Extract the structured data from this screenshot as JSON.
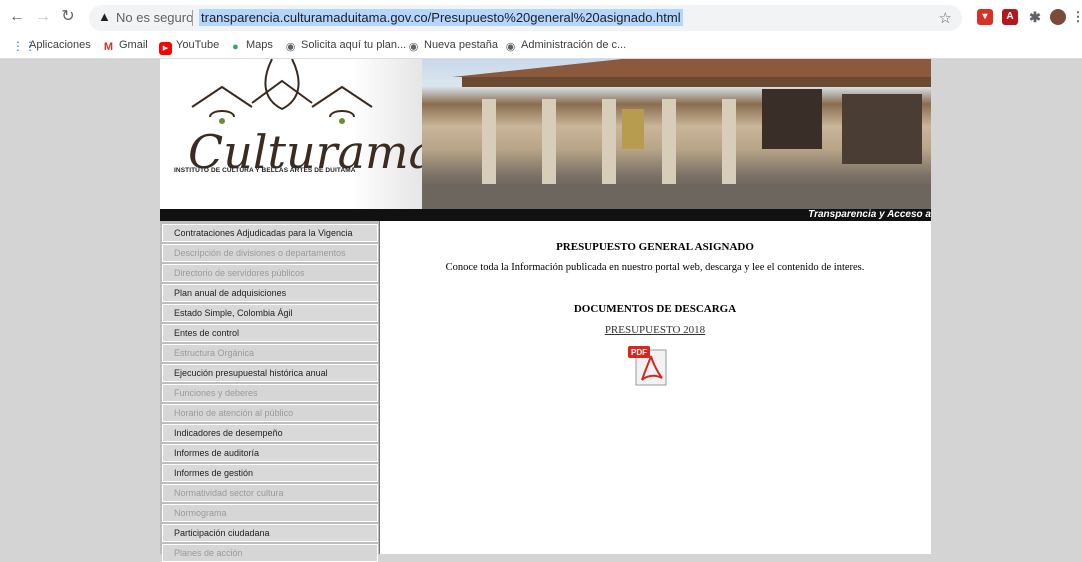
{
  "browser": {
    "insecure_label": "No es seguro",
    "url": "transparencia.culturamaduitama.gov.co/Presupuesto%20general%20asignado.html",
    "bookmarks": [
      "Aplicaciones",
      "Gmail",
      "YouTube",
      "Maps",
      "Solicita aquí tu plan...",
      "Nueva pestaña",
      "Administración de c..."
    ]
  },
  "banner": {
    "logo": "Culturama",
    "subtitle": "INSTITUTO DE CULTURA Y BELLAS ARTES DE DUITAMA",
    "tagline": "Transparencia y Acceso a"
  },
  "sidebar": {
    "items": [
      {
        "label": "Contrataciones Adjudicadas para la Vigencia",
        "dim": false
      },
      {
        "label": "Descripción de divisiones o departamentos",
        "dim": true
      },
      {
        "label": "Directorio de servidores públicos",
        "dim": true
      },
      {
        "label": "Plan anual de adquisiciones",
        "dim": false
      },
      {
        "label": "Estado Simple, Colombia Ágil",
        "dim": false
      },
      {
        "label": "Entes de control",
        "dim": false
      },
      {
        "label": "Estructura Orgánica",
        "dim": true
      },
      {
        "label": "Ejecución presupuestal histórica anual",
        "dim": false
      },
      {
        "label": "Funciones y deberes",
        "dim": true
      },
      {
        "label": "Horario de atención al público",
        "dim": true
      },
      {
        "label": "Indicadores de desempeño",
        "dim": false
      },
      {
        "label": "Informes de auditoría",
        "dim": false
      },
      {
        "label": "Informes de gestión",
        "dim": false
      },
      {
        "label": "Normatividad sector cultura",
        "dim": true
      },
      {
        "label": "Normograma",
        "dim": true
      },
      {
        "label": "Participación ciudadana",
        "dim": false
      },
      {
        "label": "Planes de acción",
        "dim": true
      }
    ]
  },
  "content": {
    "title": "PRESUPUESTO GENERAL ASIGNADO",
    "intro": "Conoce toda la Información publicada en nuestro portal web, descarga y lee el contenido de interes.",
    "downloads_title": "DOCUMENTOS DE DESCARGA",
    "link": "PRESUPUESTO 2018",
    "pdf_label": "PDF"
  }
}
